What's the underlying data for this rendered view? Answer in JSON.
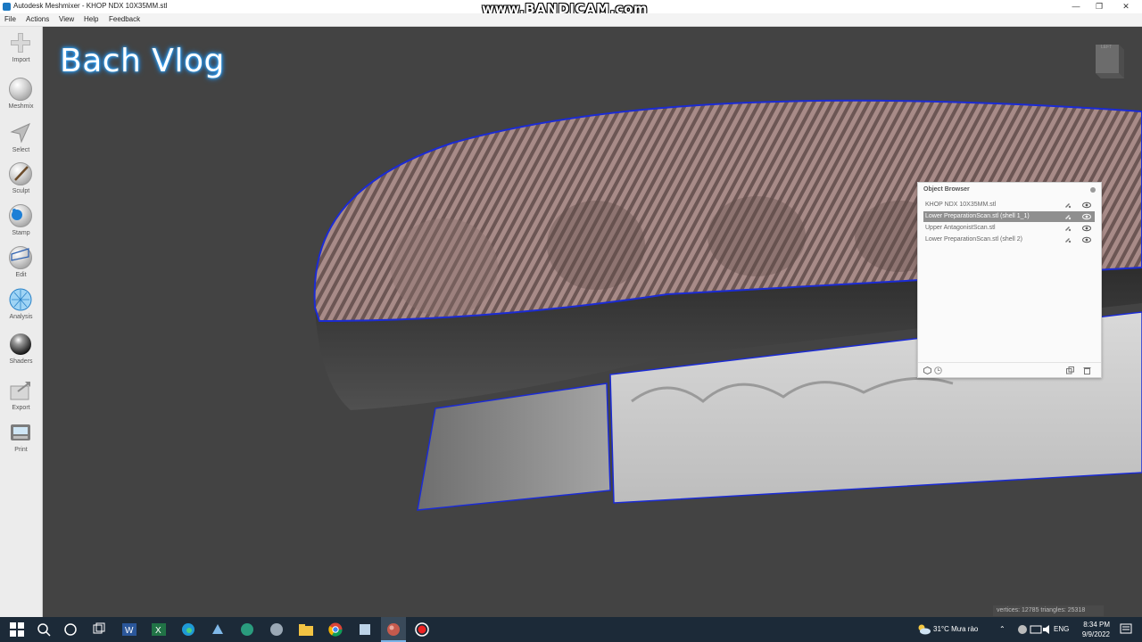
{
  "window": {
    "title": "Autodesk Meshmixer - KHOP NDX 10X35MM.stl",
    "watermark": "www.BANDICAM.com"
  },
  "menu": [
    "File",
    "Actions",
    "View",
    "Help",
    "Feedback"
  ],
  "tools": [
    {
      "label": "Import",
      "icon": "import-icon"
    },
    {
      "label": "Meshmix",
      "icon": "meshmix-icon"
    },
    {
      "label": "Select",
      "icon": "select-icon"
    },
    {
      "label": "Sculpt",
      "icon": "sculpt-icon"
    },
    {
      "label": "Stamp",
      "icon": "stamp-icon"
    },
    {
      "label": "Edit",
      "icon": "edit-icon"
    },
    {
      "label": "Analysis",
      "icon": "analysis-icon"
    },
    {
      "label": "Shaders",
      "icon": "shaders-icon"
    },
    {
      "label": "Export",
      "icon": "export-icon"
    },
    {
      "label": "Print",
      "icon": "print-icon"
    }
  ],
  "viewport": {
    "overlay_title": "Bach Vlog",
    "viewcube_label": "LEFT",
    "stats": "vertices: 12785 triangles: 25318"
  },
  "object_browser": {
    "title": "Object Browser",
    "items": [
      {
        "name": "KHOP NDX 10X35MM.stl",
        "selected": false
      },
      {
        "name": "Lower PreparationScan.stl (shell 1_1)",
        "selected": true
      },
      {
        "name": "Upper AntagonistScan.stl",
        "selected": false
      },
      {
        "name": "Lower PreparationScan.stl (shell 2)",
        "selected": false
      }
    ]
  },
  "taskbar": {
    "weather": "31°C  Mưa rào",
    "language": "ENG",
    "time": "8:34 PM",
    "date": "9/9/2022"
  },
  "colors": {
    "viewport_bg": "#434343",
    "outline_blue": "#1b2bd4",
    "selected_row": "#8f8f8f",
    "taskbar": "#1c2a38"
  }
}
